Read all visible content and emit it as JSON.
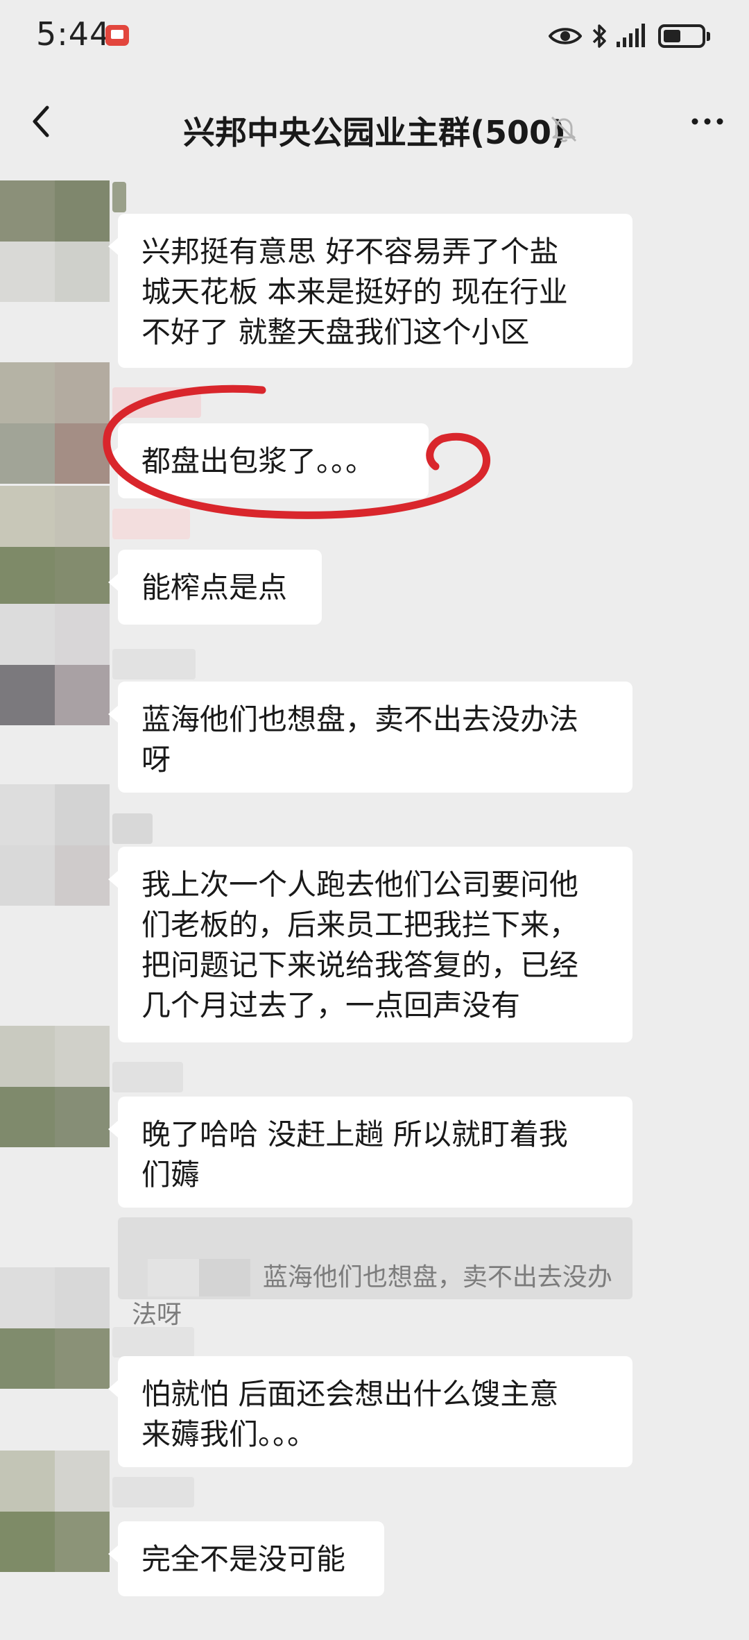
{
  "status_bar": {
    "time": "5:44",
    "icons": [
      "notification-icon",
      "eye-icon",
      "bluetooth-icon",
      "signal-icon",
      "battery-icon"
    ]
  },
  "header": {
    "title": "兴邦中央公园业主群(500)",
    "icons": [
      "back-icon",
      "mute-bell-icon",
      "more-icon"
    ]
  },
  "messages": [
    {
      "text": "兴邦挺有意思 好不容易弄了个盐\n城天花板 本来是挺好的 现在行业\n不好了 就整天盘我们这个小区"
    },
    {
      "text": "都盘出包浆了。。。",
      "highlighted": true
    },
    {
      "text": "能榨点是点"
    },
    {
      "text": "蓝海他们也想盘，卖不出去没办法\n呀"
    },
    {
      "text": "我上次一个人跑去他们公司要问他\n们老板的，后来员工把我拦下来，\n把问题记下来说给我答复的，已经\n几个月过去了，一点回声没有"
    },
    {
      "text": "晚了哈哈 没赶上趟 所以就盯着我\n们薅",
      "quote": "蓝海他们也想盘，卖不出去没办\n法呀"
    },
    {
      "text": "怕就怕 后面还会想出什么馊主意\n来薅我们。。。"
    },
    {
      "text": "完全不是没可能"
    }
  ],
  "colors": {
    "background": "#ededed",
    "bubble": "#ffffff",
    "quote_background": "#dddddd",
    "annotation_circle": "#d9262c"
  }
}
